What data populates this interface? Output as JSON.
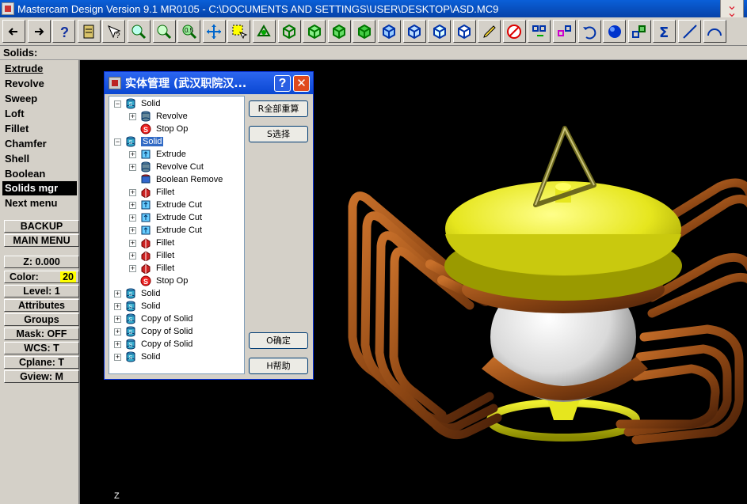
{
  "window": {
    "title": "Mastercam Design Version 9.1 MR0105 - C:\\DOCUMENTS AND SETTINGS\\USER\\DESKTOP\\ASD.MC9"
  },
  "toolbar": {
    "buttons": [
      "back-arrow",
      "forward-arrow",
      "help",
      "page",
      "pointer-query",
      "zoom-window",
      "zoom",
      "zoom-out",
      "pan",
      "select",
      "rotate",
      "cube-iso",
      "cube-top",
      "cube-front",
      "cube-side",
      "cube-blue-1",
      "cube-blue-2",
      "cube-blue-3",
      "cube-blue-4",
      "pencil",
      "eraser-no",
      "transform-1",
      "transform-2",
      "undo",
      "shade-sphere",
      "layer-boxes",
      "sigma",
      "line",
      "arc"
    ]
  },
  "status": {
    "text": "Solids:"
  },
  "menu": {
    "items": [
      "Extrude",
      "Revolve",
      "Sweep",
      "Loft",
      "Fillet",
      "Chamfer",
      "Shell",
      "Boolean",
      "Solids mgr",
      "Next menu"
    ],
    "backup": "BACKUP",
    "main_menu": "MAIN MENU",
    "z": "Z:  0.000",
    "color_label": "Color:",
    "color_value": "20",
    "level": "Level:  1",
    "attributes": "Attributes",
    "groups": "Groups",
    "mask": "Mask:  OFF",
    "wcs": "WCS:   T",
    "cplane": "Cplane:  T",
    "gview": "Gview:   M"
  },
  "viewport": {
    "axis_label": "Z"
  },
  "dialog": {
    "title": "实体管理 (武汉职院汉...",
    "help": "?",
    "close": "✕",
    "buttons": {
      "recompute": "R全部重算",
      "select": "S选择",
      "ok": "O确定",
      "help": "H帮助"
    },
    "tree": [
      {
        "label": "Solid",
        "expander": "−",
        "level": 0,
        "icon": "solid"
      },
      {
        "label": "Revolve",
        "expander": "+",
        "level": 1,
        "icon": "revolve"
      },
      {
        "label": "Stop Op",
        "expander": "",
        "level": 1,
        "icon": "stop"
      },
      {
        "label": "Solid",
        "expander": "−",
        "level": 0,
        "icon": "solid",
        "selected": true
      },
      {
        "label": "Extrude",
        "expander": "+",
        "level": 1,
        "icon": "extrude"
      },
      {
        "label": "Revolve Cut",
        "expander": "+",
        "level": 1,
        "icon": "revolve"
      },
      {
        "label": "Boolean Remove",
        "expander": "",
        "level": 1,
        "icon": "boolean"
      },
      {
        "label": "Fillet",
        "expander": "+",
        "level": 1,
        "icon": "fillet"
      },
      {
        "label": "Extrude Cut",
        "expander": "+",
        "level": 1,
        "icon": "extrude"
      },
      {
        "label": "Extrude Cut",
        "expander": "+",
        "level": 1,
        "icon": "extrude"
      },
      {
        "label": "Extrude Cut",
        "expander": "+",
        "level": 1,
        "icon": "extrude"
      },
      {
        "label": "Fillet",
        "expander": "+",
        "level": 1,
        "icon": "fillet"
      },
      {
        "label": "Fillet",
        "expander": "+",
        "level": 1,
        "icon": "fillet"
      },
      {
        "label": "Fillet",
        "expander": "+",
        "level": 1,
        "icon": "fillet"
      },
      {
        "label": "Stop Op",
        "expander": "",
        "level": 1,
        "icon": "stop"
      },
      {
        "label": "Solid",
        "expander": "+",
        "level": 0,
        "icon": "solid"
      },
      {
        "label": "Solid",
        "expander": "+",
        "level": 0,
        "icon": "solid"
      },
      {
        "label": "Copy of Solid",
        "expander": "+",
        "level": 0,
        "icon": "solid"
      },
      {
        "label": "Copy of Solid",
        "expander": "+",
        "level": 0,
        "icon": "solid"
      },
      {
        "label": "Copy of Solid",
        "expander": "+",
        "level": 0,
        "icon": "solid"
      },
      {
        "label": "Solid",
        "expander": "+",
        "level": 0,
        "icon": "solid"
      }
    ]
  },
  "colors": {
    "titlebar": "#0642a8",
    "selection": "#316ac5",
    "lantern_lid": "#e6e61e",
    "lantern_frame": "#8b4513",
    "lantern_globe": "#ffffff"
  }
}
